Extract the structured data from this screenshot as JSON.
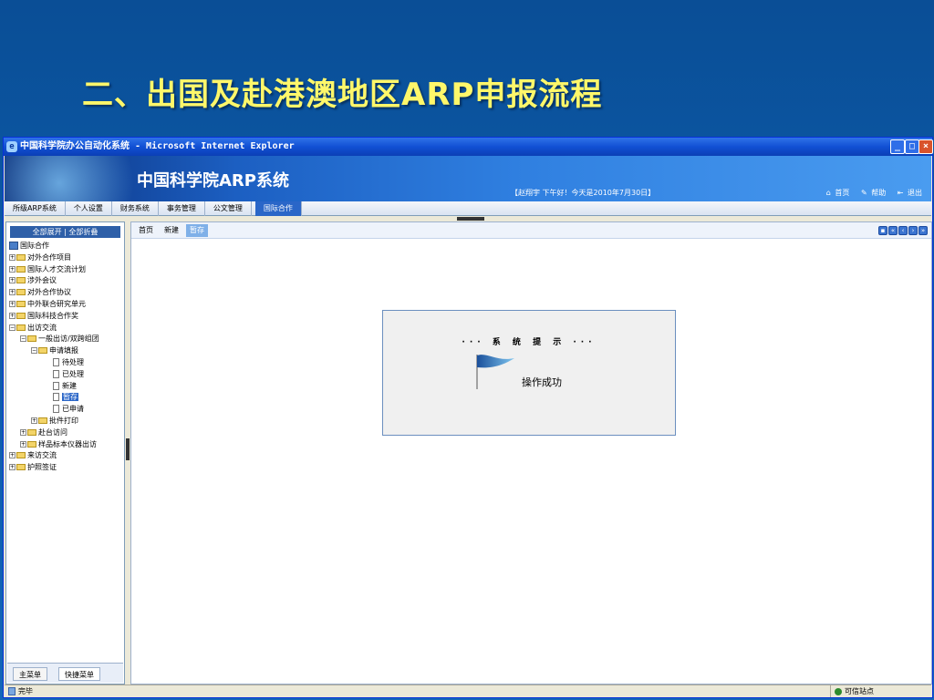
{
  "slide": {
    "title": "二、出国及赴港澳地区ARP申报流程"
  },
  "window": {
    "title": "中国科学院办公自动化系统 - Microsoft Internet Explorer",
    "buttons": {
      "minimize": "_",
      "maximize": "□",
      "close": "×"
    }
  },
  "banner": {
    "title": "中国科学院ARP系统",
    "user_greeting": "【赵翔宇 下午好！今天是2010年7月30日】",
    "links": {
      "home": "首页",
      "help": "帮助",
      "logout": "退出"
    }
  },
  "menubar": {
    "items": [
      "所级ARP系统",
      "个人设置",
      "财务系统",
      "事务管理",
      "公文管理",
      "国际合作"
    ],
    "active": "国际合作"
  },
  "leftpane": {
    "expand_all": "全部展开 | 全部折叠",
    "tree": [
      {
        "label": "国际合作"
      },
      {
        "label": "对外合作项目"
      },
      {
        "label": "国际人才交流计划"
      },
      {
        "label": "涉外会议"
      },
      {
        "label": "对外合作协议"
      },
      {
        "label": "中外联合研究单元"
      },
      {
        "label": "国际科技合作奖"
      },
      {
        "label": "出访交流"
      },
      {
        "label": "一般出访/双跨组团"
      },
      {
        "label": "申请填报"
      },
      {
        "label": "待处理"
      },
      {
        "label": "已处理"
      },
      {
        "label": "新建"
      },
      {
        "label": "暂存"
      },
      {
        "label": "已申请"
      },
      {
        "label": "批件打印"
      },
      {
        "label": "赴台访问"
      },
      {
        "label": "样品标本仪器出访"
      },
      {
        "label": "来访交流"
      },
      {
        "label": "护照签证"
      }
    ],
    "bottom_tabs": {
      "main_menu": "主菜单",
      "quick_menu": "快捷菜单"
    }
  },
  "main": {
    "tabs": [
      "首页",
      "新建",
      "暂存"
    ],
    "active_tab": "暂存",
    "nav_buttons": [
      "▪",
      "«",
      "‹",
      "›",
      "»"
    ],
    "dialog": {
      "title": "··· 系 统 提 示 ···",
      "message": "操作成功"
    }
  },
  "statusbar": {
    "left": "完毕",
    "right": "可信站点"
  },
  "colors": {
    "slide_bg": "#0c5aa8",
    "title_yellow": "#fff76a",
    "titlebar_blue": "#1150d4",
    "active_tab": "#2a66c8"
  }
}
